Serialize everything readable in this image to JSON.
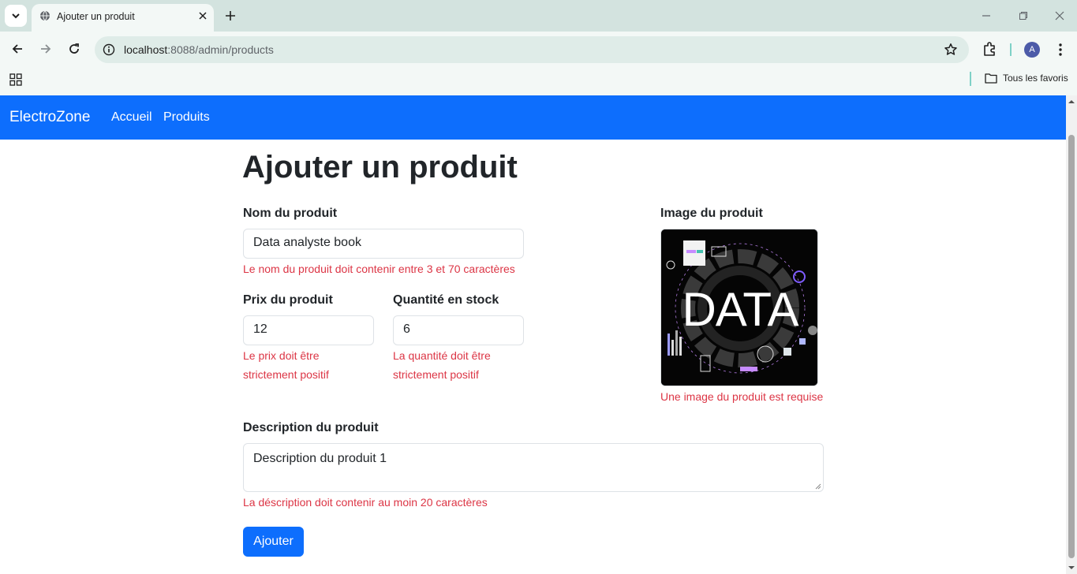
{
  "browser": {
    "tab_title": "Ajouter un produit",
    "url_host": "localhost",
    "url_path": ":8088/admin/products",
    "profile_initial": "A",
    "bookmarks_all": "Tous les favoris"
  },
  "navbar": {
    "brand": "ElectroZone",
    "links": [
      "Accueil",
      "Produits"
    ],
    "color": "#0d6efd"
  },
  "form": {
    "heading": "Ajouter un produit",
    "name": {
      "label": "Nom du produit",
      "value": "Data analyste book",
      "error": "Le nom du produit doit contenir entre 3 et 70 caractères"
    },
    "price": {
      "label": "Prix du produit",
      "value": "12",
      "error_line1": "Le prix doit être",
      "error_line2": "strictement positif"
    },
    "stock": {
      "label": "Quantité en stock",
      "value": "6",
      "error_line1": "La quantité doit être",
      "error_line2": "strictement positif"
    },
    "image": {
      "label": "Image du produit",
      "caption_text": "DATA",
      "error": "Une image du produit est requise"
    },
    "description": {
      "label": "Description du produit",
      "value": "Description du produit 1",
      "error": "La déscription doit contenir au moin 20 caractères"
    },
    "submit_label": "Ajouter",
    "error_color": "#dc3545"
  }
}
